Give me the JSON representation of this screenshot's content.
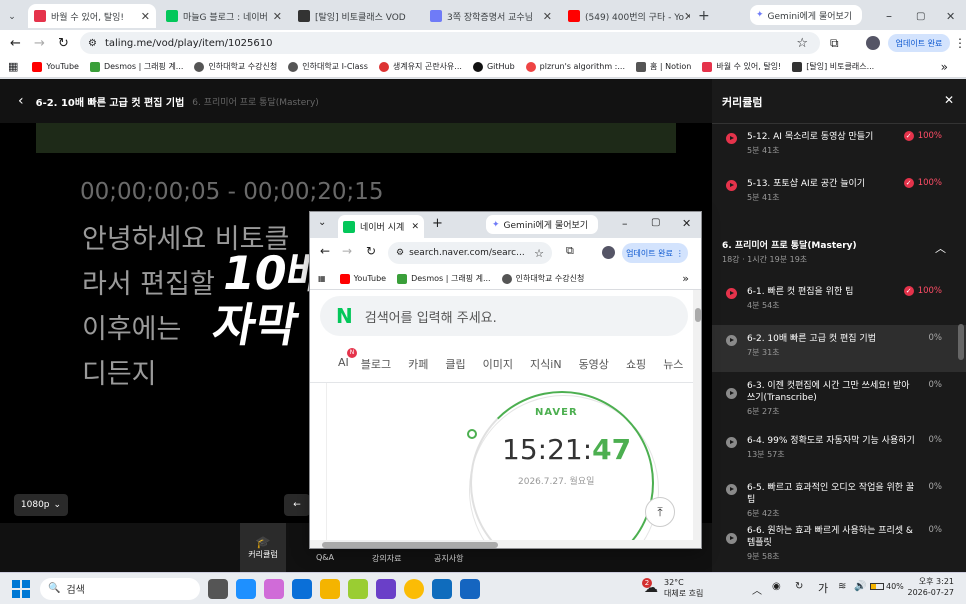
{
  "tabs": [
    {
      "label": "바월 수 있어, 탈잉!",
      "color": "#e5334b"
    },
    {
      "label": "마늘G 블로그 : 네이버",
      "color": "#03c75a"
    },
    {
      "label": "[탈잉] 비토클래스 VOD",
      "color": "#333333"
    },
    {
      "label": "3쪽 장학증명서 교수님",
      "color": "#6f7bf7"
    },
    {
      "label": "(549) 400번의 구타 - Yo",
      "color": "#ff0000"
    }
  ],
  "gemini_tab": "Gemini에게 물어보기",
  "url": "taling.me/vod/play/item/1025610",
  "update_btn": "업데이트 완료",
  "bookmarks": [
    {
      "label": "YouTube",
      "color": "#ff0000"
    },
    {
      "label": "Desmos | 그래핑 계...",
      "color": "#3a9f3a"
    },
    {
      "label": "인하대학교 수강신청",
      "color": "#555555"
    },
    {
      "label": "인하대학교 I-Class",
      "color": "#555555"
    },
    {
      "label": "생계유지 곤란사유...",
      "color": "#d33"
    },
    {
      "label": "GitHub",
      "color": "#111111"
    },
    {
      "label": "plzrun's algorithm :...",
      "color": "#e44"
    },
    {
      "label": "홈 | Notion",
      "color": "#555555"
    },
    {
      "label": "바월 수 있어, 탈잉!",
      "color": "#e5334b"
    },
    {
      "label": "[탈잉] 비토클래스...",
      "color": "#333333"
    }
  ],
  "player": {
    "lesson_title": "6-2. 10배 빠른 고급 컷 편집 기법",
    "chapter": "6. 프리미어 프로 통달(Mastery)",
    "timecode": "00;00;00;05 - 00;00;20;15",
    "sub_lines": [
      "안녕하세요 비토클",
      "라서 편집할",
      "이후에는",
      "디든지"
    ],
    "overlay": "10배",
    "overlay2": "자막",
    "quality": "1080p",
    "nav": [
      {
        "label": "커리큘럼"
      },
      {
        "label": "Q&A"
      },
      {
        "label": "강의자료"
      },
      {
        "label": "공지사항"
      }
    ]
  },
  "curriculum": {
    "title": "커리큘럼",
    "items_top": [
      {
        "title": "5-12. AI 목소리로 동영상 만들기",
        "dur": "5분 41초",
        "pct": "100%"
      },
      {
        "title": "5-13. 포토샵 AI로 공간 늘이기",
        "dur": "5분 41초",
        "pct": "100%"
      }
    ],
    "section": {
      "title": "6. 프리미어 프로 통달(Mastery)",
      "meta": "18강 · 1시간 19분 19초"
    },
    "items": [
      {
        "title": "6-1. 빠른 컷 편집을 위한 팁",
        "dur": "4분 54초",
        "pct": "100%"
      },
      {
        "title": "6-2. 10배 빠른 고급 컷 편집 기법",
        "dur": "7분 31초",
        "pct": "0%"
      },
      {
        "title": "6-3. 이젠 컷편집에 시간 그만 쓰세요! 받아쓰기(Transcribe)",
        "dur": "6분 27초",
        "pct": "0%"
      },
      {
        "title": "6-4. 99% 정확도로 자동자막 기능 사용하기",
        "dur": "13분 57초",
        "pct": "0%"
      },
      {
        "title": "6-5. 빠르고 효과적인 오디오 작업을 위한 꿀팁",
        "dur": "6분 42초",
        "pct": "0%"
      },
      {
        "title": "6-6. 원하는 효과 빠르게 사용하는 프리셋 & 템플릿",
        "dur": "9분 58초",
        "pct": "0%"
      }
    ]
  },
  "popup": {
    "tab": "네이버 시계",
    "gemini": "Gemini에게 물어보기",
    "url": "search.naver.com/searc...",
    "update": "업데이트 완료",
    "bookmarks": [
      "YouTube",
      "Desmos | 그래핑 계...",
      "인하대학교 수강신청"
    ],
    "search_placeholder": "검색어를 입력해 주세요.",
    "ai_badge": "N",
    "nav": [
      "AI",
      "블로그",
      "카페",
      "클립",
      "이미지",
      "지식iN",
      "동영상",
      "쇼핑",
      "뉴스"
    ],
    "brand": "NAVER",
    "time_hm": "15:21:",
    "time_s": "47",
    "date": "2026.7.27. 월요일"
  },
  "taskbar": {
    "search": "검색",
    "weather_temp": "32°C",
    "weather_desc": "대체로 흐림",
    "weather_badge": "2",
    "lang": "가",
    "battery": "40%",
    "time": "오후 3:21",
    "date": "2026-07-27"
  }
}
